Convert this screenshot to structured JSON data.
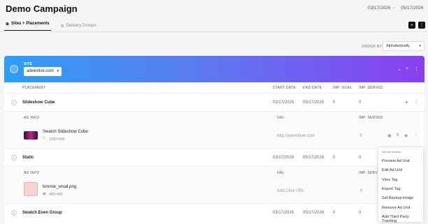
{
  "header": {
    "title": "Demo Campaign",
    "start_date": "03/17/2026",
    "separator": "-",
    "end_date": "05/17/2026"
  },
  "tabs": [
    {
      "label": "Sites + Placements"
    },
    {
      "label": "Delivery Groups"
    }
  ],
  "toolbar": {
    "add_label": "+",
    "more_label": "⋮"
  },
  "order": {
    "label": "ORDER BY",
    "value": "Alphabetically"
  },
  "site": {
    "label": "SITE",
    "value": "adventive.com"
  },
  "table": {
    "headers": {
      "placement": "PLACEMENT",
      "start": "START DATE",
      "end": "END DATE",
      "goal": "IMP. GOAL",
      "served": "IMP. SERVED"
    },
    "sub_headers": {
      "ad_info": "AD INFO",
      "url": "URL",
      "served": "IMP. SERVED"
    },
    "placements": [
      {
        "name": "Slideshow Cube",
        "start": "03/17/2026",
        "end": "05/17/2026",
        "goal": "0",
        "served": "0"
      },
      {
        "name": "Static",
        "start": "03/17/2026",
        "end": "05/17/2026",
        "goal": "0",
        "served": "0"
      },
      {
        "name": "Swatch Even Group",
        "start": "03/17/2026",
        "end": "05/17/2026",
        "goal": "0",
        "served": "0"
      }
    ],
    "ads": [
      {
        "name": "Swatch Slideshow Cube",
        "size": "1200×500",
        "url": "http://adventive.com",
        "served": "0"
      },
      {
        "name": "kimmie_small.png",
        "size": "400×400",
        "url": "Add Click URL",
        "served": "0"
      }
    ]
  },
  "menu": {
    "title": "Ad Unit Actions",
    "items": [
      "Preview Ad Unit",
      "Edit Ad Unit",
      "View Tag",
      "Export Tag",
      "Set Backup image",
      "Remove Ad Unit",
      "Add Third Party Tracking"
    ]
  },
  "colors": {
    "banner_start": "#2e9ff5",
    "banner_end": "#8a3ff0",
    "accent": "#111111"
  }
}
